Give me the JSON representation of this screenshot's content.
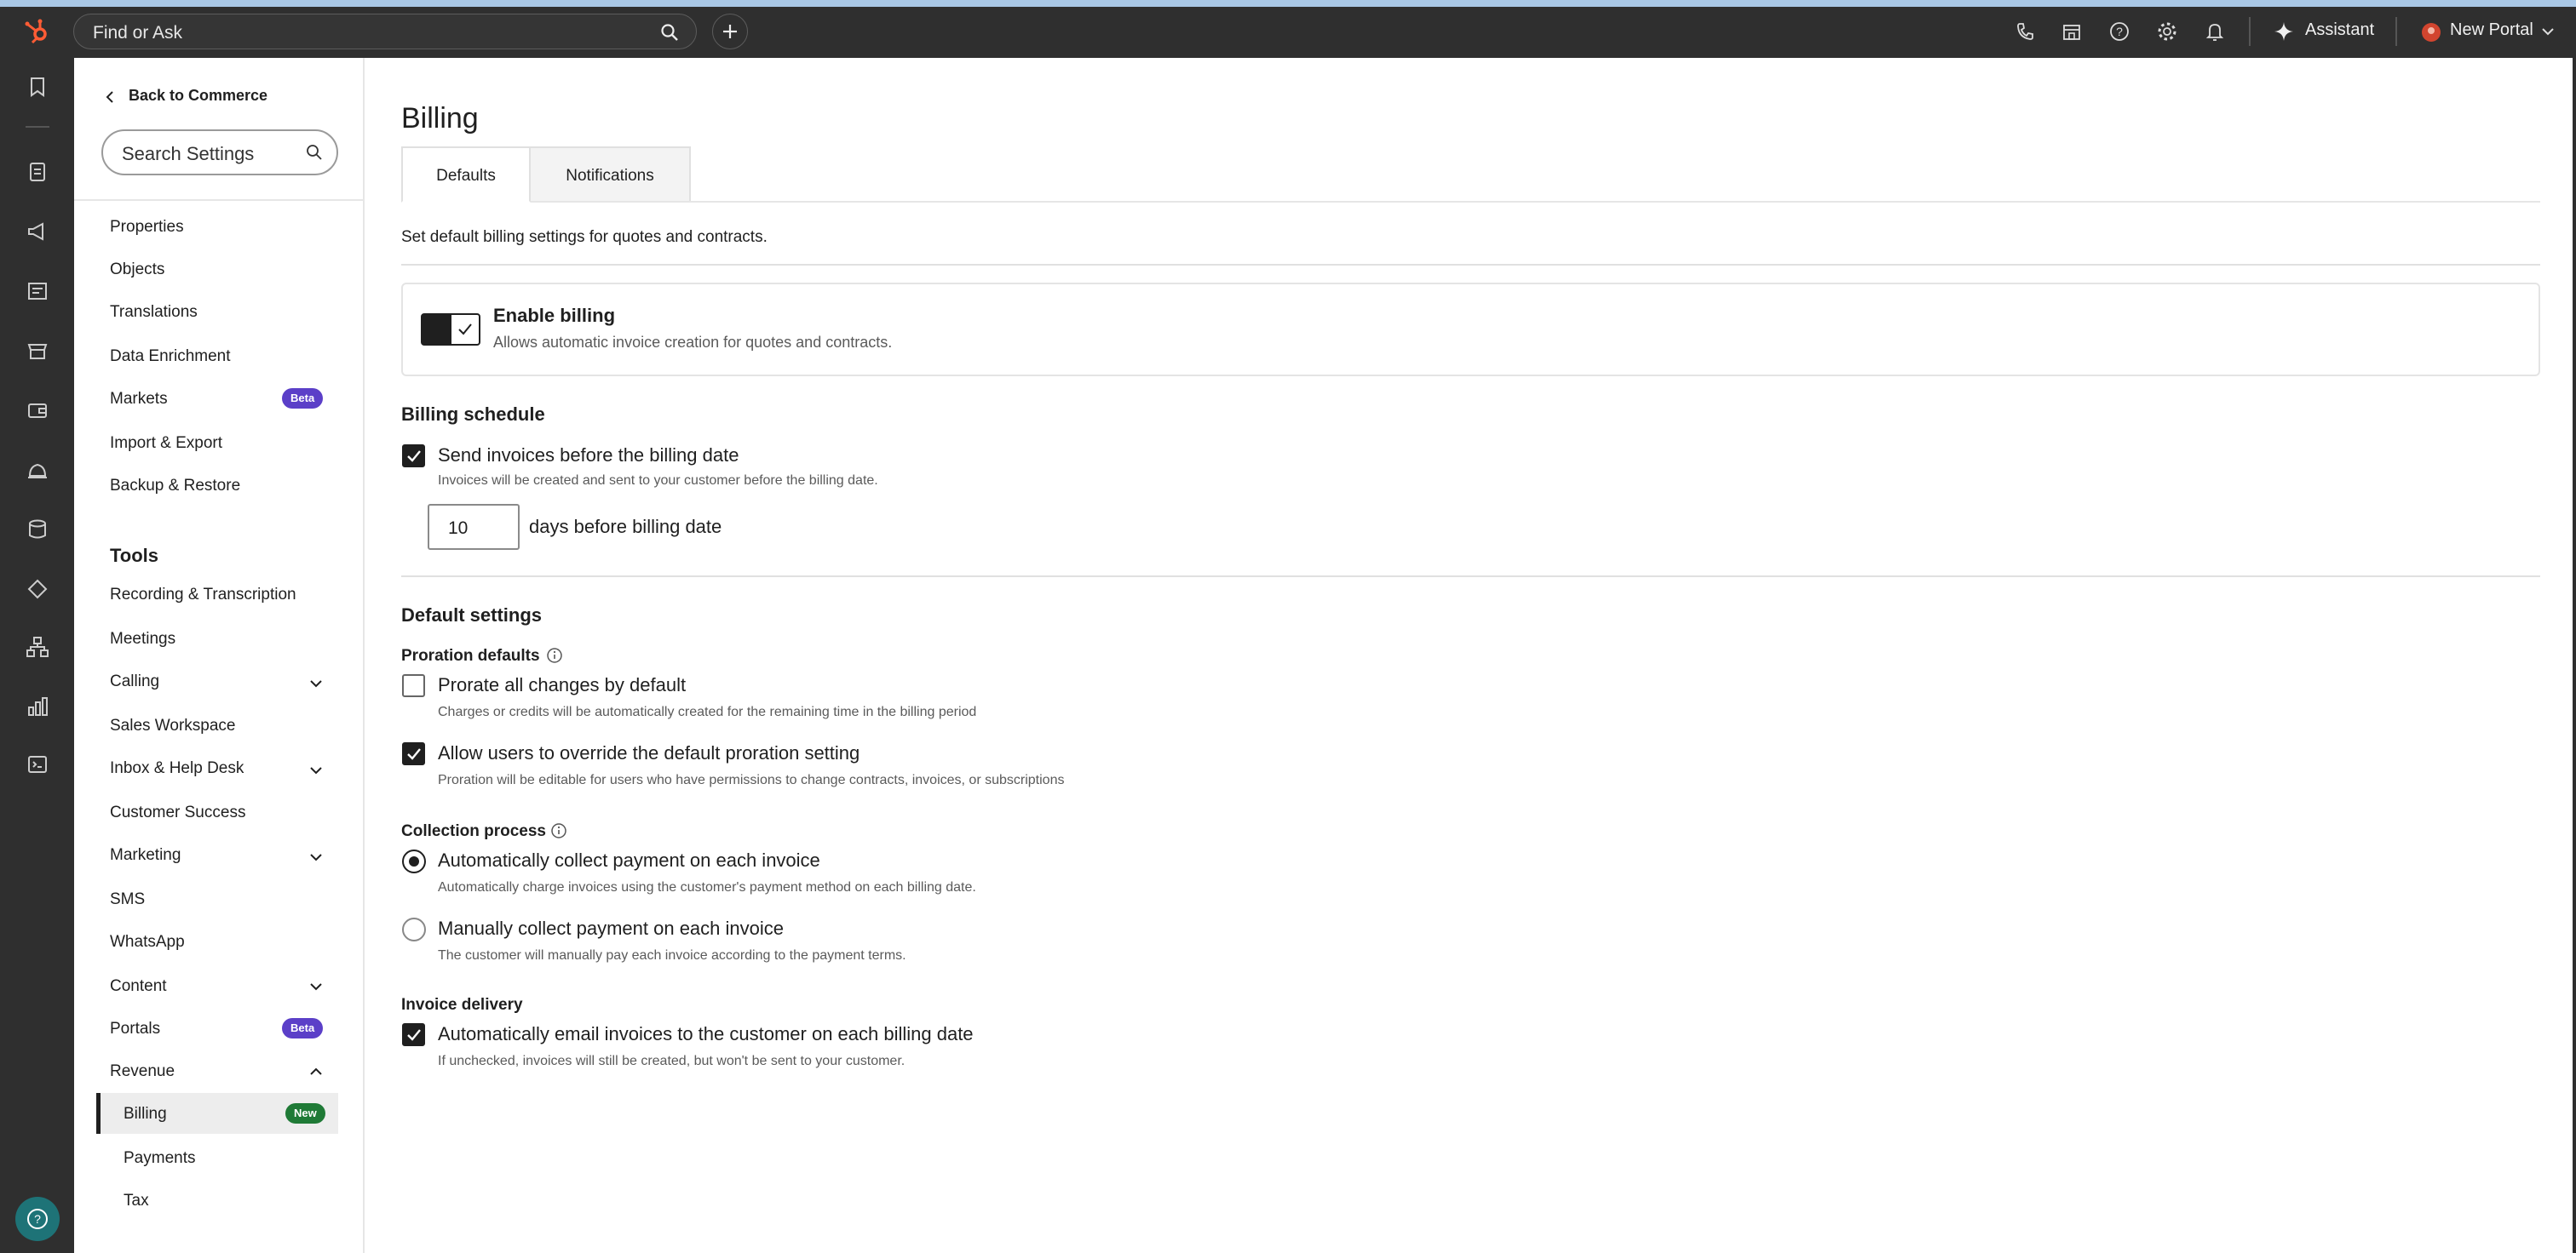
{
  "topbar": {
    "search_placeholder": "Find or Ask",
    "assistant_label": "Assistant",
    "portal_label": "New Portal"
  },
  "sidebar": {
    "back_label": "Back to Commerce",
    "search_placeholder": "Search Settings",
    "items_top": [
      {
        "label": "Properties"
      },
      {
        "label": "Objects"
      },
      {
        "label": "Translations"
      },
      {
        "label": "Data Enrichment"
      },
      {
        "label": "Markets",
        "badge": "Beta"
      },
      {
        "label": "Import & Export"
      },
      {
        "label": "Backup & Restore"
      }
    ],
    "tools_heading": "Tools",
    "tools": [
      {
        "label": "Recording & Transcription"
      },
      {
        "label": "Meetings"
      },
      {
        "label": "Calling",
        "expandable": true
      },
      {
        "label": "Sales Workspace"
      },
      {
        "label": "Inbox & Help Desk",
        "expandable": true
      },
      {
        "label": "Customer Success"
      },
      {
        "label": "Marketing",
        "expandable": true
      },
      {
        "label": "SMS"
      },
      {
        "label": "WhatsApp"
      },
      {
        "label": "Content",
        "expandable": true
      },
      {
        "label": "Portals",
        "badge": "Beta"
      },
      {
        "label": "Revenue",
        "expanded": true
      }
    ],
    "revenue_children": [
      {
        "label": "Billing",
        "badge": "New",
        "selected": true
      },
      {
        "label": "Payments"
      },
      {
        "label": "Tax"
      }
    ]
  },
  "main": {
    "title": "Billing",
    "tabs": [
      {
        "label": "Defaults",
        "active": true
      },
      {
        "label": "Notifications",
        "active": false
      }
    ],
    "description": "Set default billing settings for quotes and contracts.",
    "enable_billing": {
      "title": "Enable billing",
      "help": "Allows automatic invoice creation for quotes and contracts.",
      "enabled": true
    },
    "billing_schedule": {
      "heading": "Billing schedule",
      "send_before": {
        "label": "Send invoices before the billing date",
        "help": "Invoices will be created and sent to your customer before the billing date.",
        "checked": true
      },
      "days_value": "10",
      "days_suffix": "days before billing date"
    },
    "default_settings": {
      "heading": "Default settings",
      "proration_label": "Proration defaults",
      "prorate_all": {
        "label": "Prorate all changes by default",
        "help": "Charges or credits will be automatically created for the remaining time in the billing period",
        "checked": false
      },
      "allow_override": {
        "label": "Allow users to override the default proration setting",
        "help": "Proration will be editable for users who have permissions to change contracts, invoices, or subscriptions",
        "checked": true
      },
      "collection_label": "Collection process",
      "auto_collect": {
        "label": "Automatically collect payment on each invoice",
        "help": "Automatically charge invoices using the customer's payment method on each billing date.",
        "selected": true
      },
      "manual_collect": {
        "label": "Manually collect payment on each invoice",
        "help": "The customer will manually pay each invoice according to the payment terms.",
        "selected": false
      },
      "delivery_label": "Invoice delivery",
      "auto_email": {
        "label": "Automatically email invoices to the customer on each billing date",
        "help": "If unchecked, invoices will still be created, but won't be sent to your customer.",
        "checked": true
      }
    }
  },
  "colors": {
    "topbar": "#2f2f2f",
    "brand": "#ff5c35",
    "beta_badge": "#5b3fc8",
    "new_badge": "#1f7a36",
    "help_button": "#1e7377"
  },
  "icons": [
    "hubspot-logo-icon",
    "search-icon",
    "plus-icon",
    "phone-icon",
    "marketplace-icon",
    "help-icon",
    "gear-icon",
    "bell-icon",
    "sparkle-icon",
    "avatar-icon"
  ]
}
